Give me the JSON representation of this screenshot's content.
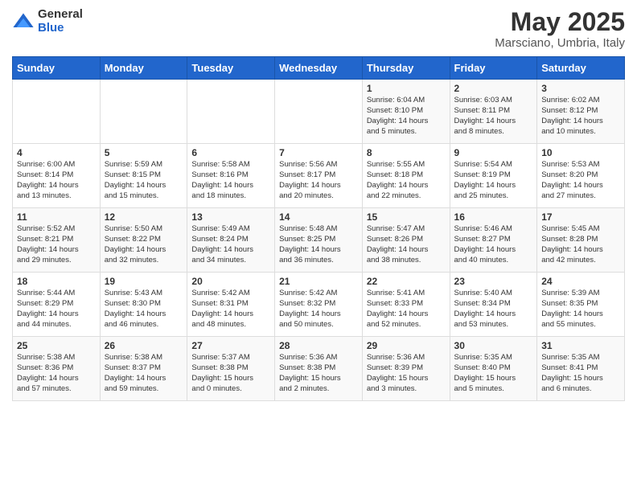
{
  "logo": {
    "general": "General",
    "blue": "Blue"
  },
  "title": {
    "month": "May 2025",
    "location": "Marsciano, Umbria, Italy"
  },
  "headers": [
    "Sunday",
    "Monday",
    "Tuesday",
    "Wednesday",
    "Thursday",
    "Friday",
    "Saturday"
  ],
  "weeks": [
    [
      {
        "day": "",
        "info": ""
      },
      {
        "day": "",
        "info": ""
      },
      {
        "day": "",
        "info": ""
      },
      {
        "day": "",
        "info": ""
      },
      {
        "day": "1",
        "info": "Sunrise: 6:04 AM\nSunset: 8:10 PM\nDaylight: 14 hours\nand 5 minutes."
      },
      {
        "day": "2",
        "info": "Sunrise: 6:03 AM\nSunset: 8:11 PM\nDaylight: 14 hours\nand 8 minutes."
      },
      {
        "day": "3",
        "info": "Sunrise: 6:02 AM\nSunset: 8:12 PM\nDaylight: 14 hours\nand 10 minutes."
      }
    ],
    [
      {
        "day": "4",
        "info": "Sunrise: 6:00 AM\nSunset: 8:14 PM\nDaylight: 14 hours\nand 13 minutes."
      },
      {
        "day": "5",
        "info": "Sunrise: 5:59 AM\nSunset: 8:15 PM\nDaylight: 14 hours\nand 15 minutes."
      },
      {
        "day": "6",
        "info": "Sunrise: 5:58 AM\nSunset: 8:16 PM\nDaylight: 14 hours\nand 18 minutes."
      },
      {
        "day": "7",
        "info": "Sunrise: 5:56 AM\nSunset: 8:17 PM\nDaylight: 14 hours\nand 20 minutes."
      },
      {
        "day": "8",
        "info": "Sunrise: 5:55 AM\nSunset: 8:18 PM\nDaylight: 14 hours\nand 22 minutes."
      },
      {
        "day": "9",
        "info": "Sunrise: 5:54 AM\nSunset: 8:19 PM\nDaylight: 14 hours\nand 25 minutes."
      },
      {
        "day": "10",
        "info": "Sunrise: 5:53 AM\nSunset: 8:20 PM\nDaylight: 14 hours\nand 27 minutes."
      }
    ],
    [
      {
        "day": "11",
        "info": "Sunrise: 5:52 AM\nSunset: 8:21 PM\nDaylight: 14 hours\nand 29 minutes."
      },
      {
        "day": "12",
        "info": "Sunrise: 5:50 AM\nSunset: 8:22 PM\nDaylight: 14 hours\nand 32 minutes."
      },
      {
        "day": "13",
        "info": "Sunrise: 5:49 AM\nSunset: 8:24 PM\nDaylight: 14 hours\nand 34 minutes."
      },
      {
        "day": "14",
        "info": "Sunrise: 5:48 AM\nSunset: 8:25 PM\nDaylight: 14 hours\nand 36 minutes."
      },
      {
        "day": "15",
        "info": "Sunrise: 5:47 AM\nSunset: 8:26 PM\nDaylight: 14 hours\nand 38 minutes."
      },
      {
        "day": "16",
        "info": "Sunrise: 5:46 AM\nSunset: 8:27 PM\nDaylight: 14 hours\nand 40 minutes."
      },
      {
        "day": "17",
        "info": "Sunrise: 5:45 AM\nSunset: 8:28 PM\nDaylight: 14 hours\nand 42 minutes."
      }
    ],
    [
      {
        "day": "18",
        "info": "Sunrise: 5:44 AM\nSunset: 8:29 PM\nDaylight: 14 hours\nand 44 minutes."
      },
      {
        "day": "19",
        "info": "Sunrise: 5:43 AM\nSunset: 8:30 PM\nDaylight: 14 hours\nand 46 minutes."
      },
      {
        "day": "20",
        "info": "Sunrise: 5:42 AM\nSunset: 8:31 PM\nDaylight: 14 hours\nand 48 minutes."
      },
      {
        "day": "21",
        "info": "Sunrise: 5:42 AM\nSunset: 8:32 PM\nDaylight: 14 hours\nand 50 minutes."
      },
      {
        "day": "22",
        "info": "Sunrise: 5:41 AM\nSunset: 8:33 PM\nDaylight: 14 hours\nand 52 minutes."
      },
      {
        "day": "23",
        "info": "Sunrise: 5:40 AM\nSunset: 8:34 PM\nDaylight: 14 hours\nand 53 minutes."
      },
      {
        "day": "24",
        "info": "Sunrise: 5:39 AM\nSunset: 8:35 PM\nDaylight: 14 hours\nand 55 minutes."
      }
    ],
    [
      {
        "day": "25",
        "info": "Sunrise: 5:38 AM\nSunset: 8:36 PM\nDaylight: 14 hours\nand 57 minutes."
      },
      {
        "day": "26",
        "info": "Sunrise: 5:38 AM\nSunset: 8:37 PM\nDaylight: 14 hours\nand 59 minutes."
      },
      {
        "day": "27",
        "info": "Sunrise: 5:37 AM\nSunset: 8:38 PM\nDaylight: 15 hours\nand 0 minutes."
      },
      {
        "day": "28",
        "info": "Sunrise: 5:36 AM\nSunset: 8:38 PM\nDaylight: 15 hours\nand 2 minutes."
      },
      {
        "day": "29",
        "info": "Sunrise: 5:36 AM\nSunset: 8:39 PM\nDaylight: 15 hours\nand 3 minutes."
      },
      {
        "day": "30",
        "info": "Sunrise: 5:35 AM\nSunset: 8:40 PM\nDaylight: 15 hours\nand 5 minutes."
      },
      {
        "day": "31",
        "info": "Sunrise: 5:35 AM\nSunset: 8:41 PM\nDaylight: 15 hours\nand 6 minutes."
      }
    ]
  ]
}
